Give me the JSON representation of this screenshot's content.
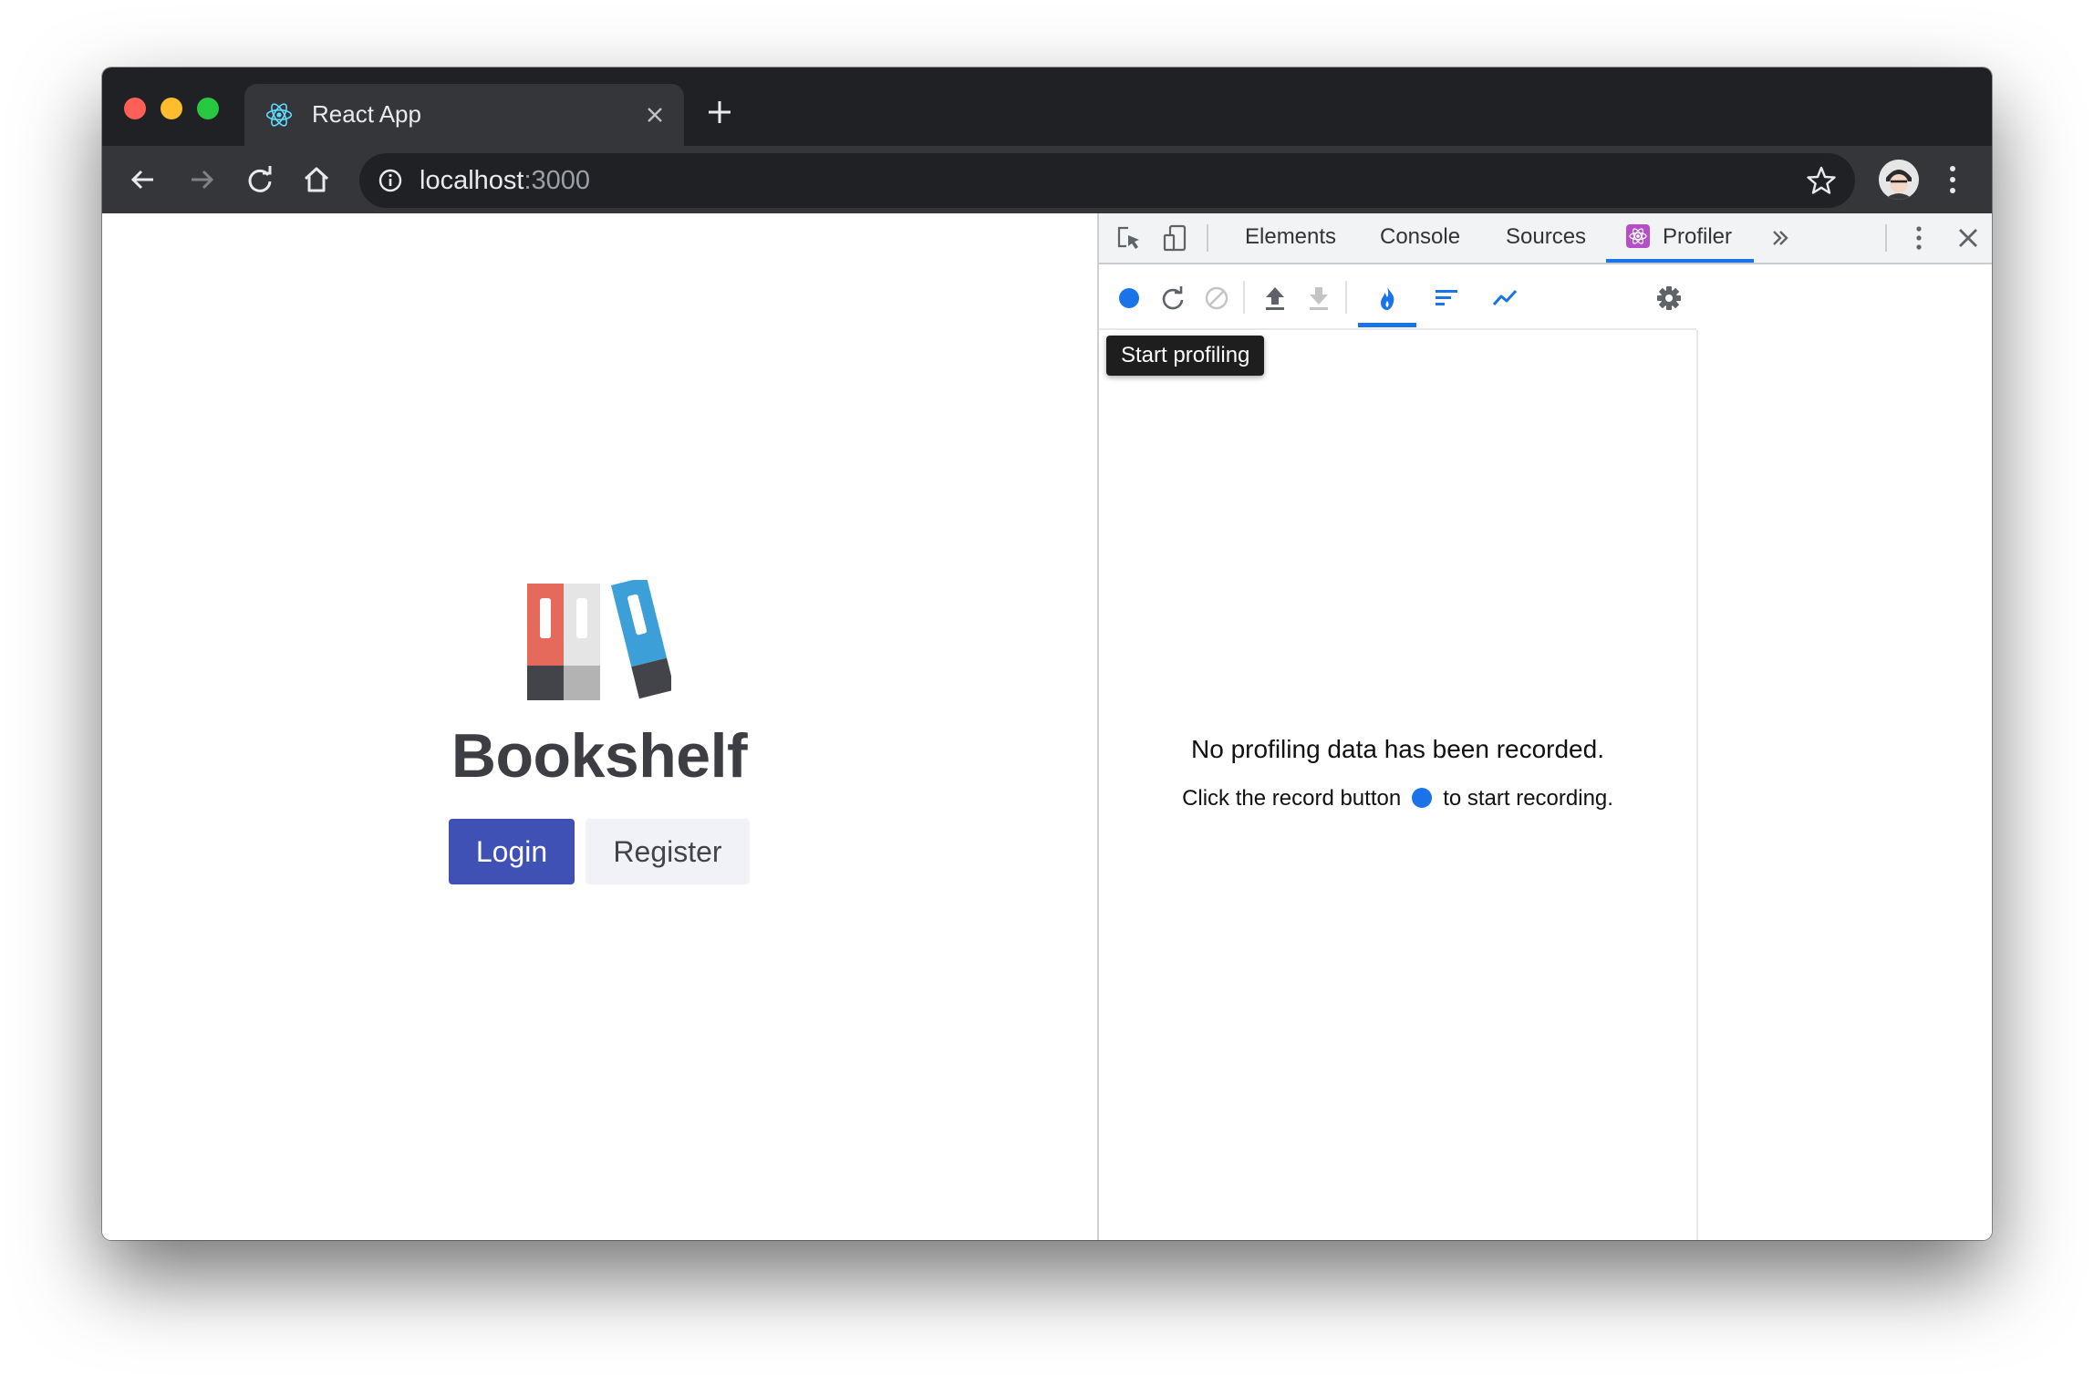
{
  "browser": {
    "tab_title": "React App",
    "url_host": "localhost",
    "url_port": ":3000",
    "colors": {
      "chrome_dark": "#202124",
      "chrome_mid": "#35363a"
    }
  },
  "page": {
    "title": "Bookshelf",
    "login_label": "Login",
    "register_label": "Register",
    "colors": {
      "primary": "#3f51b5",
      "secondary": "#f1f2f7"
    }
  },
  "devtools": {
    "tabs": [
      "Elements",
      "Console",
      "Sources",
      "Profiler"
    ],
    "active_tab": "Profiler",
    "tooltip": "Start profiling",
    "empty_title": "No profiling data has been recorded.",
    "empty_sub_before": "Click the record button",
    "empty_sub_after": "to start recording.",
    "accent": "#1a73e8"
  }
}
